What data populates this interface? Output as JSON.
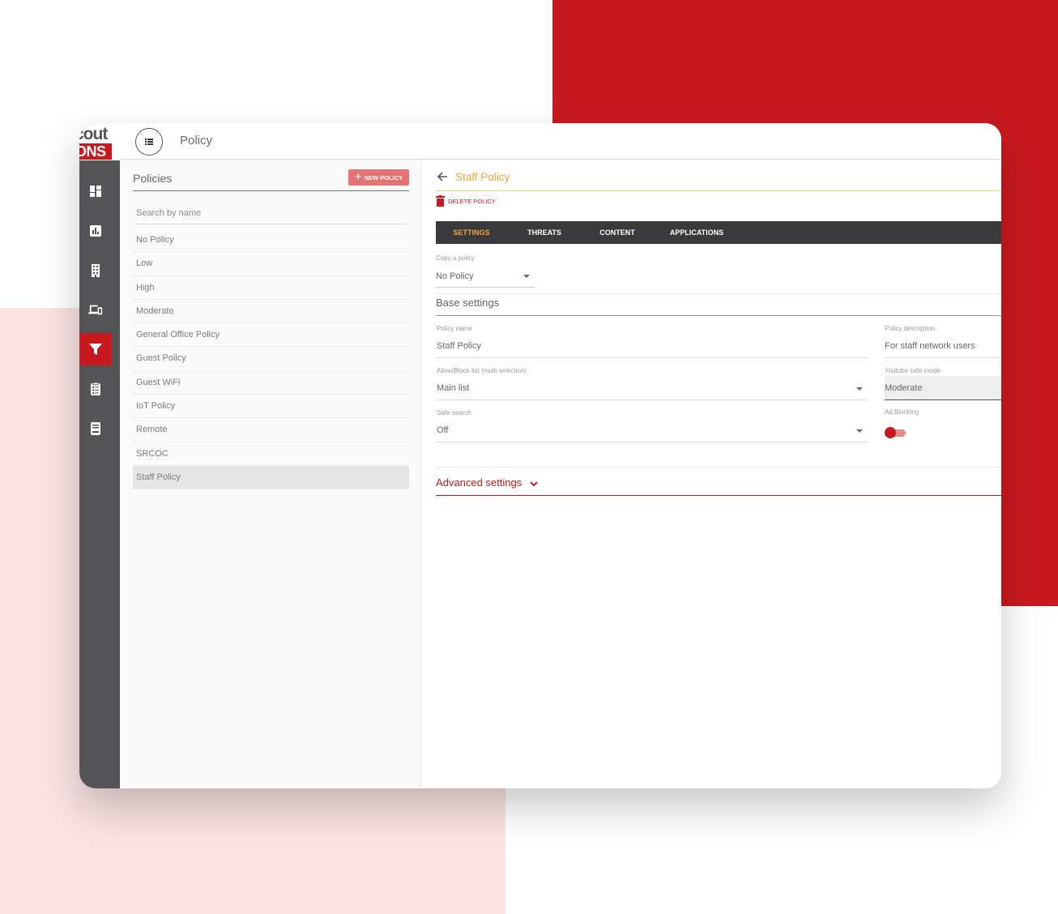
{
  "brand": {
    "logo_line1": "cout",
    "logo_line2": "DNS"
  },
  "colors": {
    "brand_red": "#c8191f",
    "accent_orange": "#f0a339",
    "sidebar_bg": "#545457",
    "tabs_bg": "#3a3a3d"
  },
  "sidebar": {
    "items": [
      {
        "icon": "dashboard-icon",
        "active": false
      },
      {
        "icon": "reports-icon",
        "active": false
      },
      {
        "icon": "building-icon",
        "active": false
      },
      {
        "icon": "devices-icon",
        "active": false
      },
      {
        "icon": "filter-icon",
        "active": true
      },
      {
        "icon": "clipboard-icon",
        "active": false
      },
      {
        "icon": "book-icon",
        "active": false
      }
    ]
  },
  "topbar": {
    "title": "Policy"
  },
  "policies": {
    "title": "Policies",
    "new_button": "NEW POLICY",
    "search_placeholder": "Search by name",
    "items": [
      "No Policy",
      "Low",
      "High",
      "Moderate",
      "General Office Policy",
      "Guest Policy",
      "Guest WiFi",
      "IoT Policy",
      "Remote",
      "SRCOC",
      "Staff Policy"
    ],
    "selected": "Staff Policy"
  },
  "details": {
    "title": "Staff Policy",
    "delete_label": "DELETE POLICY",
    "tabs": [
      "SETTINGS",
      "THREATS",
      "CONTENT",
      "APPLICATIONS"
    ],
    "active_tab": "SETTINGS",
    "copy_policy": {
      "label": "Copy a policy",
      "value": "No Policy"
    },
    "base_settings_title": "Base settings",
    "policy_name": {
      "label": "Policy name",
      "value": "Staff Policy"
    },
    "policy_description": {
      "label": "Policy description",
      "value": "For staff network users"
    },
    "allow_block": {
      "label": "Allow/Block list (multi selection)",
      "value": "Main list"
    },
    "youtube_safe": {
      "label": "Youtube safe mode",
      "value": "Moderate"
    },
    "safe_search": {
      "label": "Safe search",
      "value": "Off"
    },
    "ad_blocking": {
      "label": "Ad Blocking",
      "enabled": true
    },
    "advanced_settings": "Advanced settings"
  }
}
